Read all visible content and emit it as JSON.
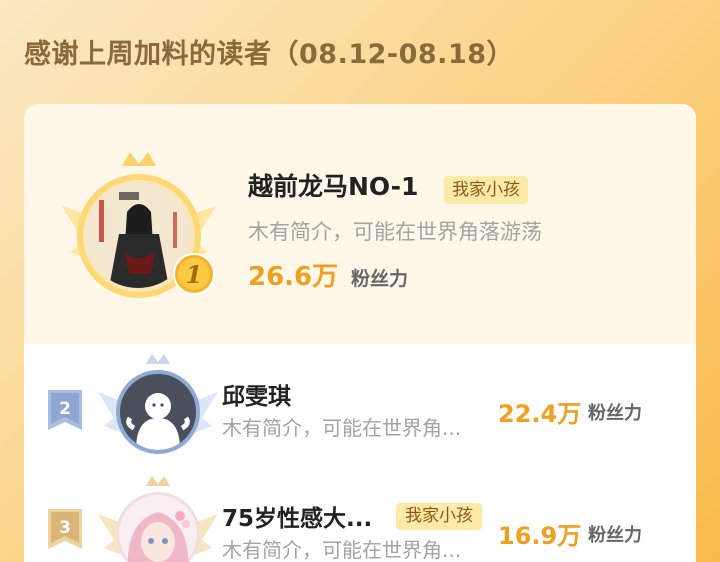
{
  "header": {
    "title": "感谢上周加料的读者（08.12-08.18）"
  },
  "readers": [
    {
      "rank": "1",
      "name": "越前龙马NO-1",
      "tag": "我家小孩",
      "desc": "木有简介，可能在世界角落游荡",
      "fans": "26.6万",
      "fans_unit": "粉丝力"
    },
    {
      "rank": "2",
      "name": "邱雯琪",
      "tag": "",
      "desc": "木有简介，可能在世界角...",
      "fans": "22.4万",
      "fans_unit": "粉丝力"
    },
    {
      "rank": "3",
      "name": "75岁性感大...",
      "tag": "我家小孩",
      "desc": "木有简介，可能在世界角...",
      "fans": "16.9万",
      "fans_unit": "粉丝力"
    }
  ],
  "colors": {
    "accent": "#f0a020",
    "tag_bg": "#fdeaa8",
    "name": "#222222",
    "desc": "#a3a3a3"
  }
}
